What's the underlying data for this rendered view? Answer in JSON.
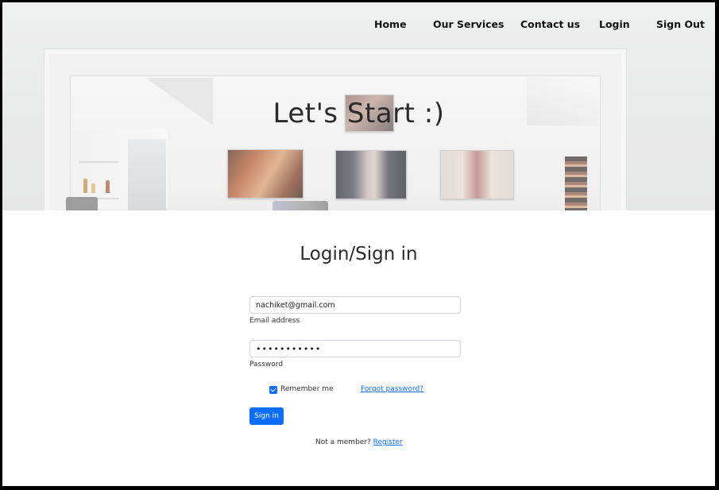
{
  "nav": {
    "home": "Home",
    "services": "Our Services",
    "contact": "Contact us",
    "login": "Login",
    "signout": "Sign Out"
  },
  "hero": {
    "title": "Let's Start :)"
  },
  "form": {
    "title": "Login/Sign in",
    "email_value": "nachiket@gmail.com",
    "email_label": "Email address",
    "password_value": "•••••••••••",
    "password_label": "Password",
    "remember_label": "Remember me",
    "remember_checked": true,
    "forgot_label": "Forgot password?",
    "signin_label": "Sign in",
    "member_text": "Not a member? ",
    "register_label": "Register"
  },
  "colors": {
    "accent": "#0d6efd",
    "text": "#2b2b2b"
  }
}
